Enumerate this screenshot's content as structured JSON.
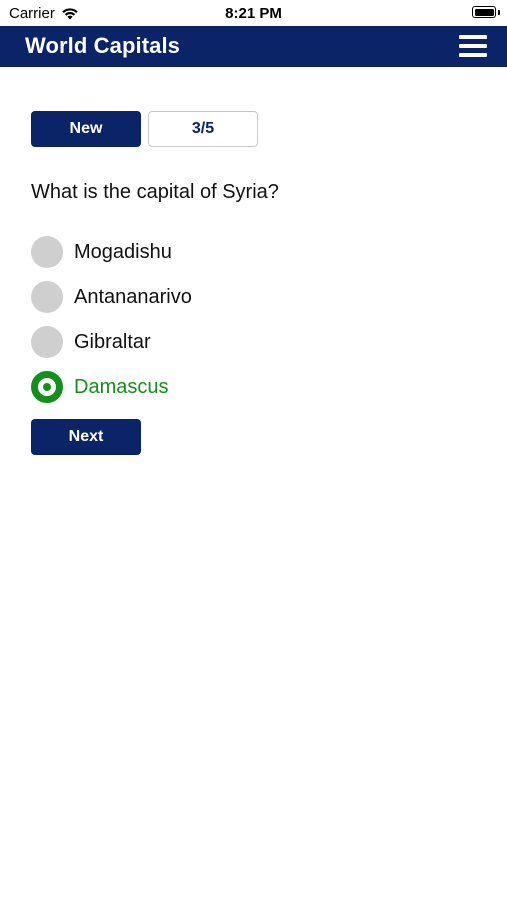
{
  "status_bar": {
    "carrier": "Carrier",
    "time": "8:21 PM",
    "wifi_icon": "wifi-icon",
    "battery_icon": "battery-icon"
  },
  "nav": {
    "title": "World Capitals",
    "menu_icon": "hamburger-menu-icon"
  },
  "controls": {
    "new_label": "New",
    "progress": "3/5",
    "next_label": "Next"
  },
  "quiz": {
    "question": "What is the capital of Syria?",
    "options": [
      {
        "label": "Mogadishu",
        "selected": false
      },
      {
        "label": "Antananarivo",
        "selected": false
      },
      {
        "label": "Gibraltar",
        "selected": false
      },
      {
        "label": "Damascus",
        "selected": true
      }
    ]
  },
  "colors": {
    "brand": "#0b2468",
    "correct": "#148f1a",
    "radio_unselected": "#cfcfcf"
  }
}
